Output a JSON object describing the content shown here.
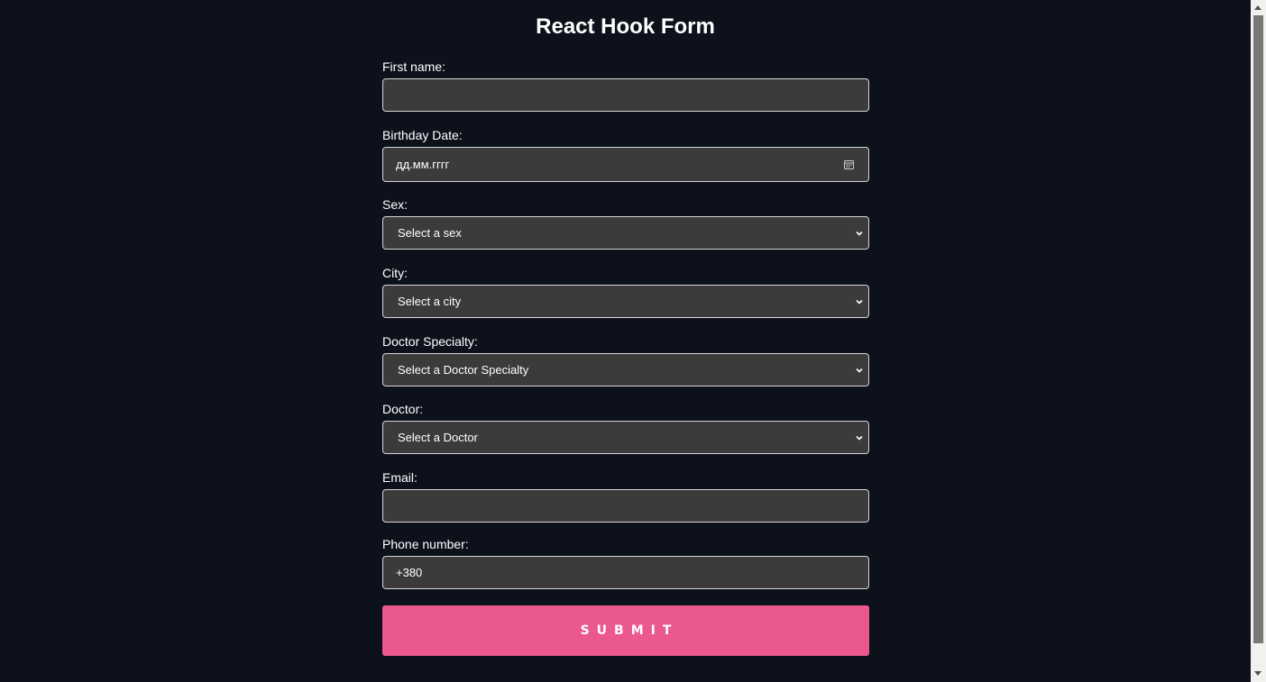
{
  "title": "React Hook Form",
  "fields": {
    "first_name": {
      "label": "First name:",
      "value": ""
    },
    "birthday": {
      "label": "Birthday Date:",
      "value": "дд.мм.гггг"
    },
    "sex": {
      "label": "Sex:",
      "value": "Select a sex"
    },
    "city": {
      "label": "City:",
      "value": "Select a city"
    },
    "specialty": {
      "label": "Doctor Specialty:",
      "value": "Select a Doctor Specialty"
    },
    "doctor": {
      "label": "Doctor:",
      "value": "Select a Doctor"
    },
    "email": {
      "label": "Email:",
      "value": ""
    },
    "phone": {
      "label": "Phone number:",
      "value": "+380"
    }
  },
  "submit_label": "SUBMIT",
  "icons": {
    "calendar": "calendar-icon",
    "select_chevron": "chevron-down-icon"
  },
  "colors": {
    "background": "#0d111c",
    "input_bg": "#3b3b3b",
    "input_border": "#d6d6d6",
    "submit_bg": "#eb5890"
  }
}
